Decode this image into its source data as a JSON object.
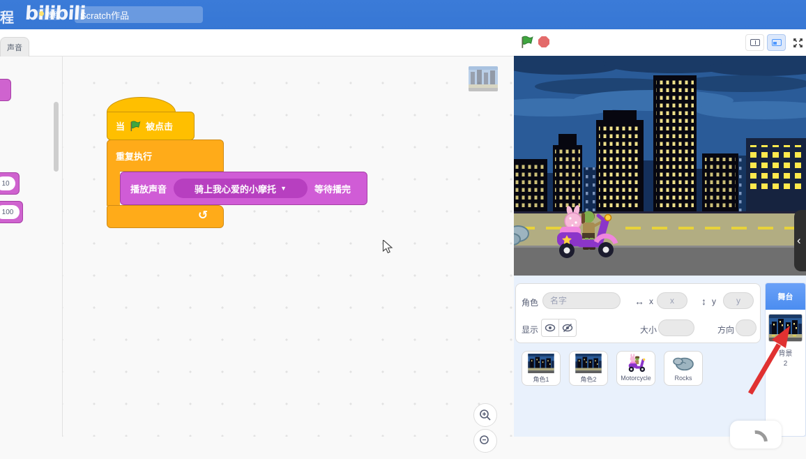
{
  "topbar": {
    "brand_fragment": "程",
    "logo_text": "bilibili",
    "badge": "教程",
    "project_title": "Scratch作品"
  },
  "tabs": {
    "sound_tab": "声音"
  },
  "palette": {
    "oval_small": "10",
    "oval_large": "100"
  },
  "code": {
    "hat_when": "当",
    "hat_clicked": "被点击",
    "forever_label": "重复执行",
    "play_prefix": "播放声音",
    "play_sound_name": "骑上我心爱的小摩托",
    "play_caret": "▼",
    "play_suffix": "等待播完",
    "loop_arrow": "↻"
  },
  "sprite_info": {
    "sprite_label": "角色",
    "name_placeholder": "名字",
    "x_icon": "↔",
    "x_label": "x",
    "x_placeholder": "x",
    "y_icon": "↕",
    "y_label": "y",
    "y_placeholder": "y",
    "show_label": "显示",
    "size_label": "大小",
    "direction_label": "方向"
  },
  "sprites": [
    {
      "name": "角色1"
    },
    {
      "name": "角色2"
    },
    {
      "name": "Motorcycle"
    },
    {
      "name": "Rocks"
    }
  ],
  "stage_panel": {
    "title": "舞台",
    "backdrop_label": "背景",
    "backdrop_count": "2",
    "collapse_glyph": "‹"
  },
  "colors": {
    "topbar_blue": "#3b7bd8",
    "events_yellow": "#ffbf00",
    "control_orange": "#ffab19",
    "sound_magenta": "#d05cd6",
    "sound_magenta_dark": "#b73fc0",
    "stage_panel_blue": "#5a96f5",
    "green_flag": "#3fa63f",
    "stop_red": "#e36a6a",
    "annotation_arrow_red": "#e03131",
    "panel_bg": "#e9f1fc"
  }
}
